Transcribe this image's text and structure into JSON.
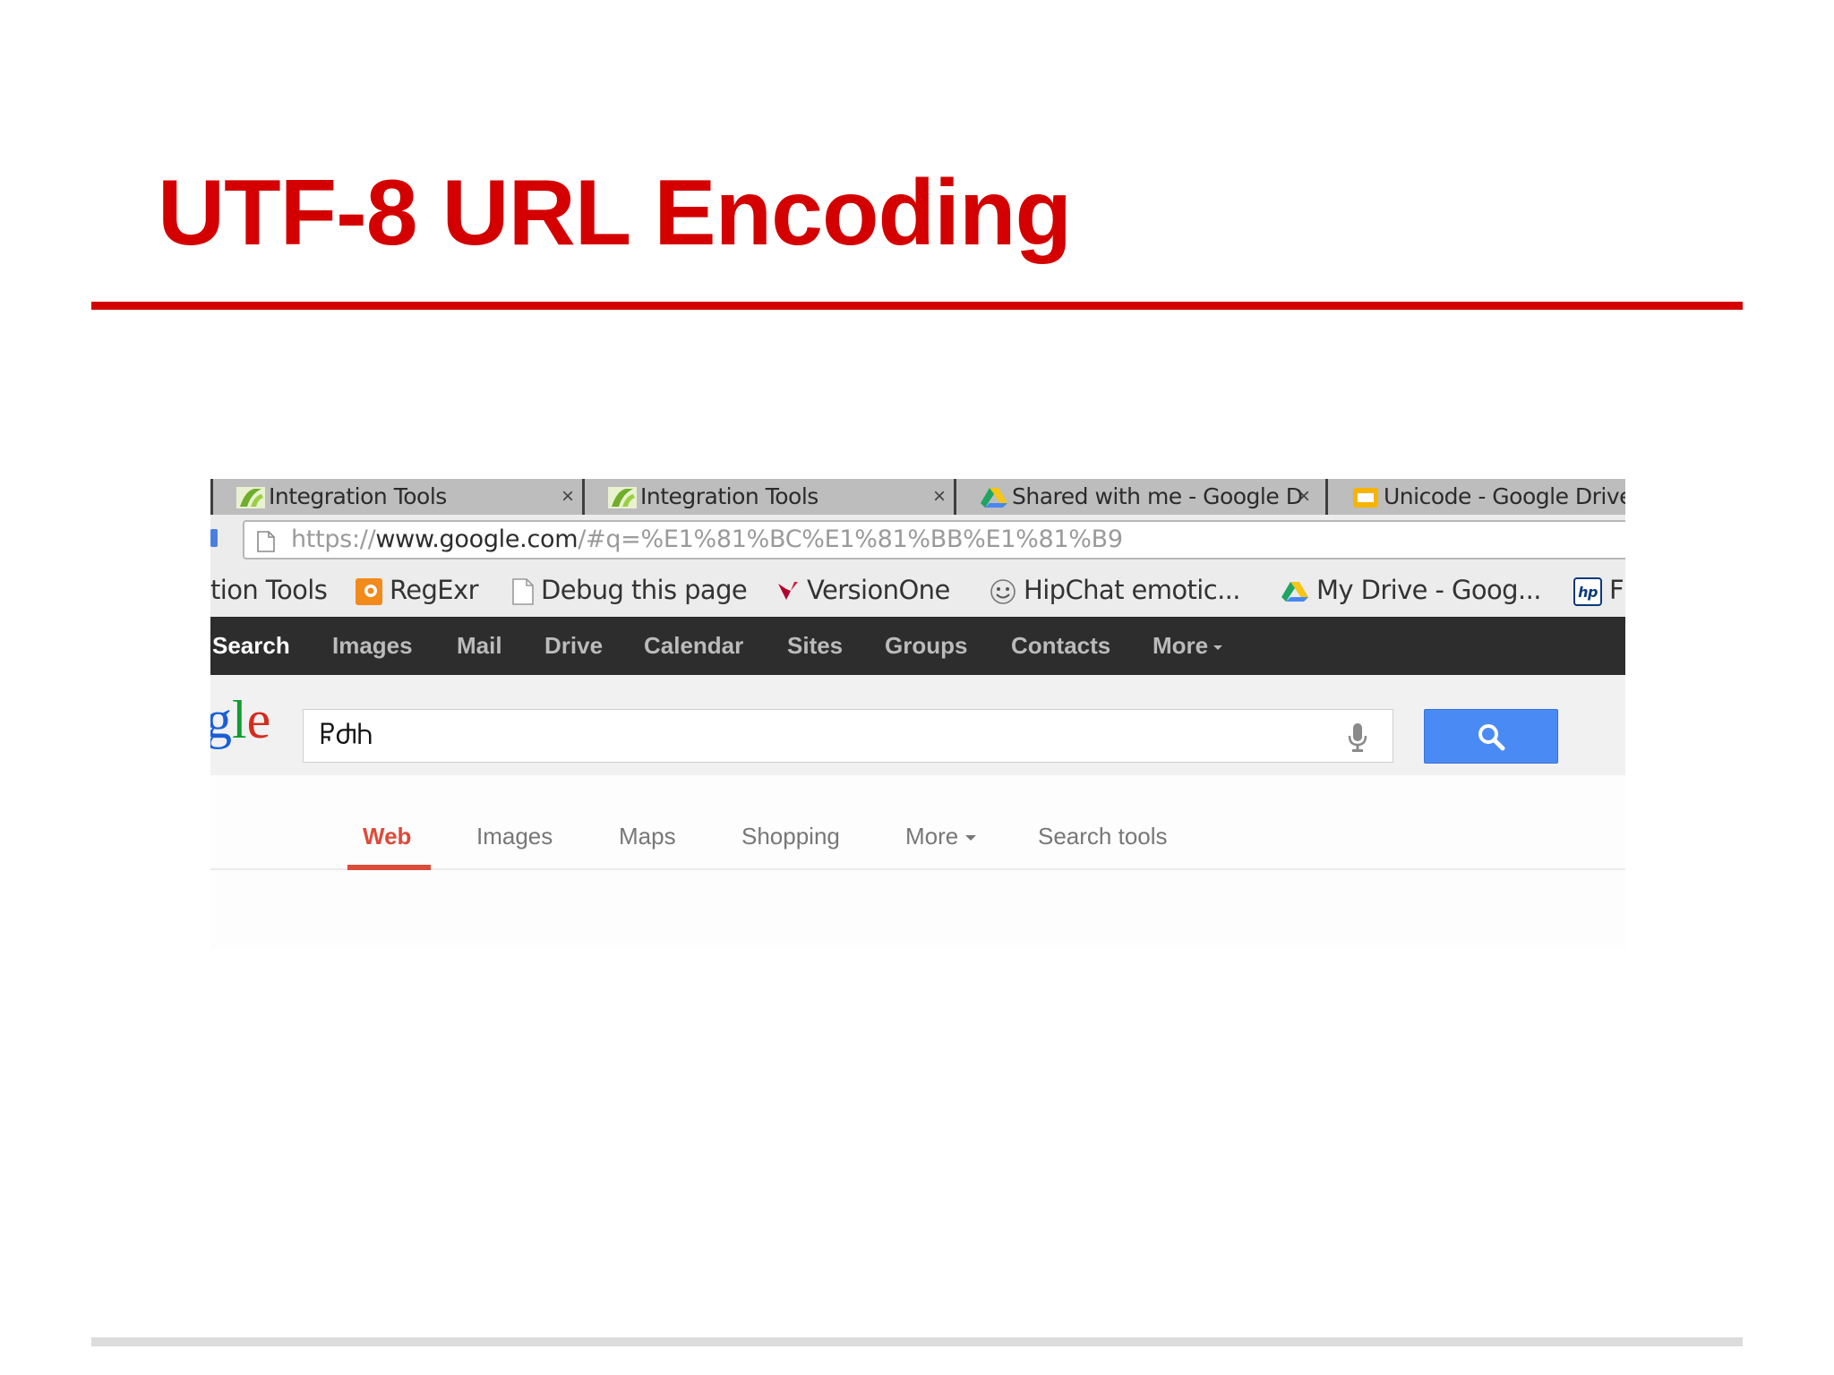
{
  "slide": {
    "title": "UTF-8 URL Encoding"
  },
  "browser": {
    "tabs": [
      {
        "title": "Integration Tools",
        "icon": "integration-tools-favicon",
        "close": "×"
      },
      {
        "title": "Integration Tools",
        "icon": "integration-tools-favicon",
        "close": "×"
      },
      {
        "title": "Shared with me - Google D",
        "icon": "google-drive-icon",
        "close": "×"
      },
      {
        "title": "Unicode - Google Drive",
        "icon": "google-slides-icon"
      }
    ],
    "url": {
      "scheme": "https://",
      "host": "www.google.com",
      "path": "/#q=%E1%81%BC%E1%81%BB%E1%81%B9"
    },
    "bookmarks": [
      {
        "label": "tion Tools",
        "icon": ""
      },
      {
        "label": "RegExr",
        "icon": "regexr-icon"
      },
      {
        "label": "Debug this page",
        "icon": "page-icon"
      },
      {
        "label": "VersionOne",
        "icon": "versionone-icon"
      },
      {
        "label": "HipChat emotic...",
        "icon": "hipchat-icon"
      },
      {
        "label": "My Drive - Goog...",
        "icon": "google-drive-icon"
      },
      {
        "label": "F",
        "icon": "hp-icon"
      }
    ]
  },
  "google": {
    "bar_items": [
      "Search",
      "Images",
      "Mail",
      "Drive",
      "Calendar",
      "Sites",
      "Groups",
      "Contacts",
      "More"
    ],
    "logo_fragment": "gle",
    "query": "ႼႻႹ",
    "result_tabs": [
      "Web",
      "Images",
      "Maps",
      "Shopping",
      "More",
      "Search tools"
    ],
    "active_tab": "Web"
  },
  "colors": {
    "title_red": "#d40000",
    "google_bar": "#2d2d2d",
    "search_button": "#4a8af4",
    "active_tab_red": "#dd4b39"
  }
}
